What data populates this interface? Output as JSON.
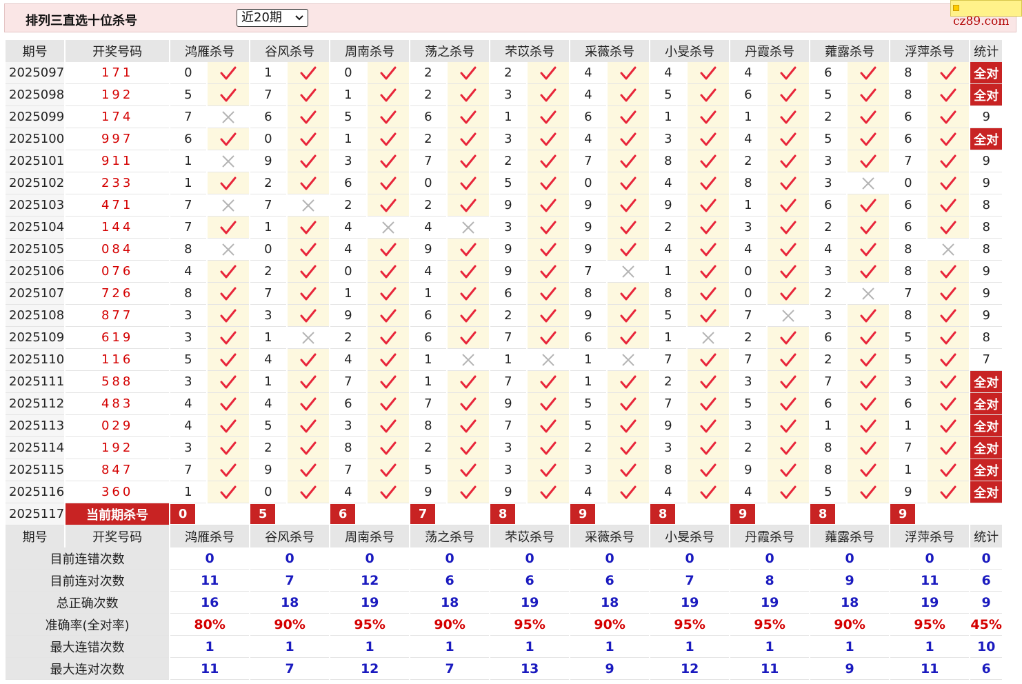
{
  "header": {
    "title": "排列三直选十位杀号",
    "period_select": "近20期",
    "logo": "cz89.com"
  },
  "colors": {
    "correct": "#e8253a",
    "wrong": "#b4b4b4",
    "highlight": "#c82323",
    "stat_value": "#1a1abf",
    "percent": "#d40000"
  },
  "icons": {
    "correct": "check-icon",
    "wrong": "cross-icon",
    "dropdown": "chevron-down-icon"
  },
  "columns": {
    "period": "期号",
    "draw": "开奖号码",
    "stats": "统计",
    "experts": [
      "鸿雁杀号",
      "谷风杀号",
      "周南杀号",
      "荡之杀号",
      "芣苡杀号",
      "采薇杀号",
      "小旻杀号",
      "丹霞杀号",
      "蕹露杀号",
      "浮萍杀号"
    ]
  },
  "rows": [
    {
      "period": "2025097",
      "draw": "171",
      "picks": [
        "0",
        "1",
        "0",
        "2",
        "2",
        "4",
        "4",
        "4",
        "6",
        "8"
      ],
      "ok": [
        1,
        1,
        1,
        1,
        1,
        1,
        1,
        1,
        1,
        1
      ],
      "stat": "全对"
    },
    {
      "period": "2025098",
      "draw": "192",
      "picks": [
        "5",
        "7",
        "1",
        "2",
        "3",
        "4",
        "5",
        "6",
        "5",
        "8"
      ],
      "ok": [
        1,
        1,
        1,
        1,
        1,
        1,
        1,
        1,
        1,
        1
      ],
      "stat": "全对"
    },
    {
      "period": "2025099",
      "draw": "174",
      "picks": [
        "7",
        "6",
        "5",
        "6",
        "1",
        "6",
        "1",
        "1",
        "2",
        "6"
      ],
      "ok": [
        0,
        1,
        1,
        1,
        1,
        1,
        1,
        1,
        1,
        1
      ],
      "stat": "9"
    },
    {
      "period": "2025100",
      "draw": "997",
      "picks": [
        "6",
        "0",
        "1",
        "2",
        "3",
        "4",
        "3",
        "4",
        "5",
        "6"
      ],
      "ok": [
        1,
        1,
        1,
        1,
        1,
        1,
        1,
        1,
        1,
        1
      ],
      "stat": "全对"
    },
    {
      "period": "2025101",
      "draw": "911",
      "picks": [
        "1",
        "9",
        "3",
        "7",
        "2",
        "7",
        "8",
        "2",
        "3",
        "7"
      ],
      "ok": [
        0,
        1,
        1,
        1,
        1,
        1,
        1,
        1,
        1,
        1
      ],
      "stat": "9"
    },
    {
      "period": "2025102",
      "draw": "233",
      "picks": [
        "1",
        "2",
        "6",
        "0",
        "5",
        "0",
        "4",
        "8",
        "3",
        "0"
      ],
      "ok": [
        1,
        1,
        1,
        1,
        1,
        1,
        1,
        1,
        0,
        1
      ],
      "stat": "9"
    },
    {
      "period": "2025103",
      "draw": "471",
      "picks": [
        "7",
        "7",
        "2",
        "2",
        "9",
        "9",
        "9",
        "1",
        "6",
        "6"
      ],
      "ok": [
        0,
        0,
        1,
        1,
        1,
        1,
        1,
        1,
        1,
        1
      ],
      "stat": "8"
    },
    {
      "period": "2025104",
      "draw": "144",
      "picks": [
        "7",
        "1",
        "4",
        "4",
        "3",
        "9",
        "2",
        "3",
        "2",
        "6"
      ],
      "ok": [
        1,
        1,
        0,
        0,
        1,
        1,
        1,
        1,
        1,
        1
      ],
      "stat": "8"
    },
    {
      "period": "2025105",
      "draw": "084",
      "picks": [
        "8",
        "0",
        "4",
        "9",
        "9",
        "9",
        "4",
        "4",
        "4",
        "8"
      ],
      "ok": [
        0,
        1,
        1,
        1,
        1,
        1,
        1,
        1,
        1,
        0
      ],
      "stat": "8"
    },
    {
      "period": "2025106",
      "draw": "076",
      "picks": [
        "4",
        "2",
        "0",
        "4",
        "9",
        "7",
        "1",
        "0",
        "3",
        "8"
      ],
      "ok": [
        1,
        1,
        1,
        1,
        1,
        0,
        1,
        1,
        1,
        1
      ],
      "stat": "9"
    },
    {
      "period": "2025107",
      "draw": "726",
      "picks": [
        "8",
        "7",
        "1",
        "1",
        "6",
        "8",
        "8",
        "0",
        "2",
        "7"
      ],
      "ok": [
        1,
        1,
        1,
        1,
        1,
        1,
        1,
        1,
        0,
        1
      ],
      "stat": "9"
    },
    {
      "period": "2025108",
      "draw": "877",
      "picks": [
        "3",
        "3",
        "9",
        "6",
        "2",
        "9",
        "5",
        "7",
        "3",
        "8"
      ],
      "ok": [
        1,
        1,
        1,
        1,
        1,
        1,
        1,
        0,
        1,
        1
      ],
      "stat": "9"
    },
    {
      "period": "2025109",
      "draw": "619",
      "picks": [
        "3",
        "1",
        "2",
        "6",
        "7",
        "6",
        "1",
        "2",
        "6",
        "5"
      ],
      "ok": [
        1,
        0,
        1,
        1,
        1,
        1,
        0,
        1,
        1,
        1
      ],
      "stat": "8"
    },
    {
      "period": "2025110",
      "draw": "116",
      "picks": [
        "5",
        "4",
        "4",
        "1",
        "1",
        "1",
        "7",
        "7",
        "2",
        "5"
      ],
      "ok": [
        1,
        1,
        1,
        0,
        0,
        0,
        1,
        1,
        1,
        1
      ],
      "stat": "7"
    },
    {
      "period": "2025111",
      "draw": "588",
      "picks": [
        "3",
        "1",
        "7",
        "1",
        "7",
        "1",
        "2",
        "3",
        "7",
        "3"
      ],
      "ok": [
        1,
        1,
        1,
        1,
        1,
        1,
        1,
        1,
        1,
        1
      ],
      "stat": "全对"
    },
    {
      "period": "2025112",
      "draw": "483",
      "picks": [
        "4",
        "4",
        "6",
        "7",
        "9",
        "5",
        "7",
        "5",
        "6",
        "6"
      ],
      "ok": [
        1,
        1,
        1,
        1,
        1,
        1,
        1,
        1,
        1,
        1
      ],
      "stat": "全对"
    },
    {
      "period": "2025113",
      "draw": "029",
      "picks": [
        "4",
        "5",
        "3",
        "8",
        "7",
        "5",
        "9",
        "3",
        "1",
        "1"
      ],
      "ok": [
        1,
        1,
        1,
        1,
        1,
        1,
        1,
        1,
        1,
        1
      ],
      "stat": "全对"
    },
    {
      "period": "2025114",
      "draw": "192",
      "picks": [
        "3",
        "2",
        "8",
        "2",
        "3",
        "2",
        "3",
        "2",
        "8",
        "7"
      ],
      "ok": [
        1,
        1,
        1,
        1,
        1,
        1,
        1,
        1,
        1,
        1
      ],
      "stat": "全对"
    },
    {
      "period": "2025115",
      "draw": "847",
      "picks": [
        "7",
        "9",
        "7",
        "5",
        "3",
        "3",
        "8",
        "9",
        "8",
        "1"
      ],
      "ok": [
        1,
        1,
        1,
        1,
        1,
        1,
        1,
        1,
        1,
        1
      ],
      "stat": "全对"
    },
    {
      "period": "2025116",
      "draw": "360",
      "picks": [
        "1",
        "0",
        "4",
        "9",
        "9",
        "4",
        "4",
        "4",
        "5",
        "9"
      ],
      "ok": [
        1,
        1,
        1,
        1,
        1,
        1,
        1,
        1,
        1,
        1
      ],
      "stat": "全对"
    }
  ],
  "current": {
    "period": "2025117",
    "label": "当前期杀号",
    "picks": [
      "0",
      "5",
      "6",
      "7",
      "8",
      "9",
      "8",
      "9",
      "8",
      "9"
    ]
  },
  "summary": [
    {
      "label": "目前连错次数",
      "values": [
        "0",
        "0",
        "0",
        "0",
        "0",
        "0",
        "0",
        "0",
        "0",
        "0"
      ],
      "stat": "0",
      "pct": false
    },
    {
      "label": "目前连对次数",
      "values": [
        "11",
        "7",
        "12",
        "6",
        "6",
        "6",
        "7",
        "8",
        "9",
        "11"
      ],
      "stat": "6",
      "pct": false
    },
    {
      "label": "总正确次数",
      "values": [
        "16",
        "18",
        "19",
        "18",
        "19",
        "18",
        "19",
        "19",
        "18",
        "19"
      ],
      "stat": "9",
      "pct": false
    },
    {
      "label": "准确率(全对率)",
      "values": [
        "80%",
        "90%",
        "95%",
        "90%",
        "95%",
        "90%",
        "95%",
        "95%",
        "90%",
        "95%"
      ],
      "stat": "45%",
      "pct": true
    },
    {
      "label": "最大连错次数",
      "values": [
        "1",
        "1",
        "1",
        "1",
        "1",
        "1",
        "1",
        "1",
        "1",
        "1"
      ],
      "stat": "10",
      "pct": false
    },
    {
      "label": "最大连对次数",
      "values": [
        "11",
        "7",
        "12",
        "7",
        "13",
        "9",
        "12",
        "11",
        "9",
        "11"
      ],
      "stat": "6",
      "pct": false
    }
  ]
}
